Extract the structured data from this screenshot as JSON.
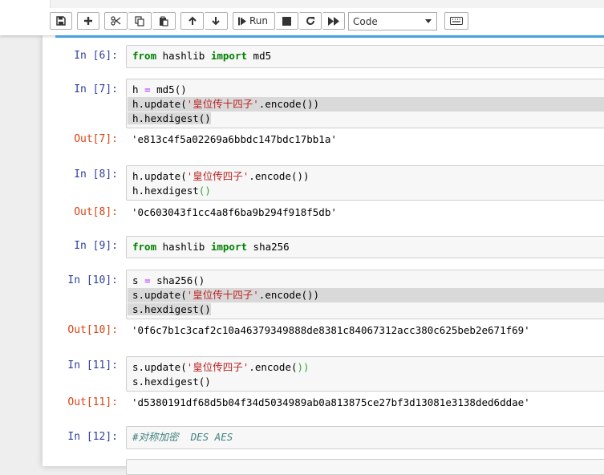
{
  "toolbar": {
    "run_label": "Run",
    "celltype_value": "Code"
  },
  "cells": [
    {
      "prompt": "In  [6]:",
      "tokens": [
        [
          "kw",
          "from"
        ],
        [
          "",
          "hashlib"
        ],
        [
          "kw",
          "import"
        ],
        [
          "",
          "md5"
        ]
      ]
    },
    {
      "prompt": "In  [7]:",
      "lines": [
        {
          "segments": [
            [
              "",
              "h "
            ],
            [
              "op",
              "="
            ],
            [
              "",
              " md5()"
            ]
          ]
        },
        {
          "segments": [
            [
              "",
              "h.update("
            ],
            [
              "str",
              "'皇位传十四子'"
            ],
            [
              "",
              ".encode())"
            ]
          ]
        },
        {
          "segments": [
            [
              "",
              "h.hexdigest()"
            ]
          ]
        }
      ],
      "out_prompt": "Out[7]:",
      "output": "'e813c4f5a02269a6bbdc147bdc17bb1a'"
    },
    {
      "prompt": "In  [8]:",
      "lines": [
        {
          "segments": [
            [
              "",
              "h.update("
            ],
            [
              "str",
              "'皇位传四子'"
            ],
            [
              "",
              ".encode())"
            ]
          ]
        },
        {
          "segments": [
            [
              "",
              "h.hexdigest"
            ],
            [
              "grn",
              "()"
            ]
          ]
        }
      ],
      "out_prompt": "Out[8]:",
      "output": "'0c603043f1cc4a8f6ba9b294f918f5db'"
    },
    {
      "prompt": "In  [9]:",
      "tokens": [
        [
          "kw",
          "from"
        ],
        [
          "",
          "hashlib"
        ],
        [
          "kw",
          "import"
        ],
        [
          "",
          "sha256"
        ]
      ]
    },
    {
      "prompt": "In  [10]:",
      "lines": [
        {
          "segments": [
            [
              "",
              "s "
            ],
            [
              "op",
              "="
            ],
            [
              "",
              " sha256()"
            ]
          ]
        },
        {
          "segments": [
            [
              "",
              "s.update("
            ],
            [
              "str",
              "'皇位传十四子'"
            ],
            [
              "",
              ".encode())"
            ]
          ]
        },
        {
          "segments": [
            [
              "",
              "s.hexdigest()"
            ]
          ]
        }
      ],
      "out_prompt": "Out[10]:",
      "output": "'0f6c7b1c3caf2c10a46379349888de8381c84067312acc380c625beb2e671f69'"
    },
    {
      "prompt": "In  [11]:",
      "lines": [
        {
          "segments": [
            [
              "",
              "s.update("
            ],
            [
              "str",
              "'皇位传四子'"
            ],
            [
              "",
              ".encode("
            ],
            [
              "grn",
              "))"
            ]
          ]
        },
        {
          "segments": [
            [
              "",
              "s.hexdigest()"
            ]
          ]
        }
      ],
      "out_prompt": "Out[11]:",
      "output": "'d5380191df68d5b04f34d5034989ab0a813875ce27bf3d13081e3138ded6ddae'"
    },
    {
      "prompt": "In  [12]:",
      "comment": "#对称加密  DES AES"
    }
  ]
}
